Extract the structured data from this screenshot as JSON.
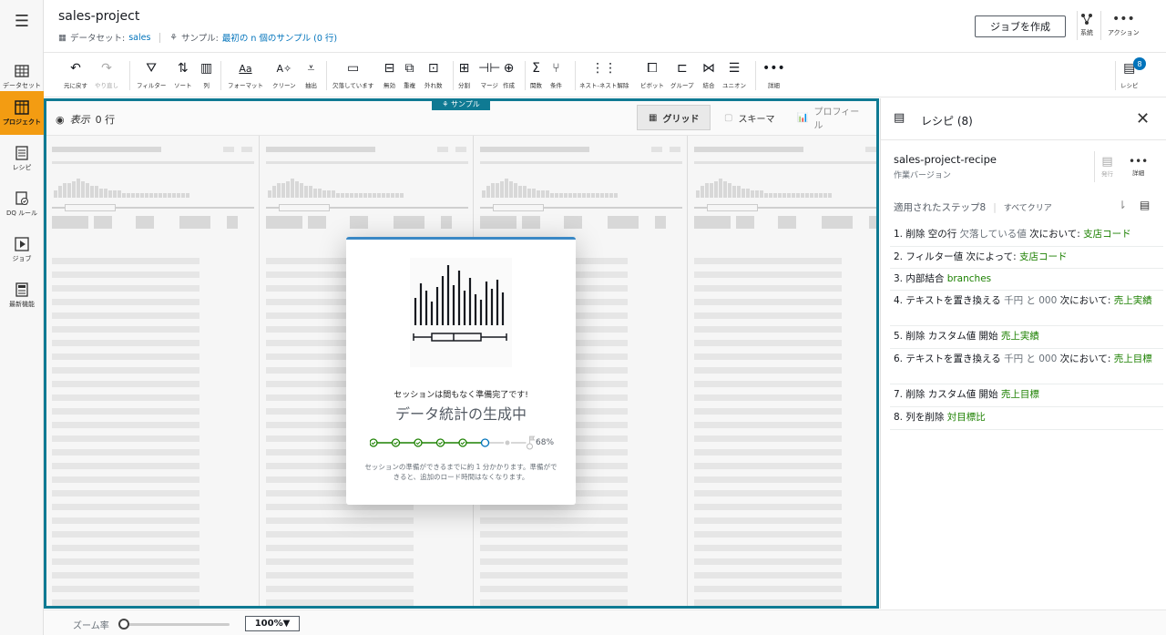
{
  "nav": {
    "items": [
      {
        "label": "データセット"
      },
      {
        "label": "プロジェクト"
      },
      {
        "label": "レシピ"
      },
      {
        "label": "DQ ルール"
      },
      {
        "label": "ジョブ"
      },
      {
        "label": "最新機能"
      }
    ]
  },
  "header": {
    "title": "sales-project",
    "dataset_label": "データセット:",
    "dataset_value": "sales",
    "sample_label": "サンプル:",
    "sample_value": "最初の n 個のサンプル (0 行)",
    "create_job": "ジョブを作成",
    "lineage": "系統",
    "actions": "アクション"
  },
  "toolbar": {
    "undo": "元に戻す",
    "redo": "やり直し",
    "filter": "フィルター",
    "sort": "ソート",
    "column": "列",
    "format": "フォーマット",
    "clean": "クリーン",
    "extract": "抽出",
    "missing": "欠落しています",
    "invalid": "無効",
    "duplicate": "重複",
    "outliers": "外れ数",
    "split": "分割",
    "merge": "マージ",
    "create": "作成",
    "functions": "関数",
    "condition": "条件",
    "nest": "ネスト-ネスト解除",
    "pivot": "ピボット",
    "group": "グループ",
    "join": "結合",
    "union": "ユニオン",
    "more": "詳細",
    "recipe": "レシピ",
    "recipe_count": "8"
  },
  "grid": {
    "sample_tag": "サンプル",
    "view_label": "表示",
    "rows": "0 行",
    "tab_grid": "グリッド",
    "tab_schema": "スキーマ",
    "tab_profile": "プロフィール"
  },
  "modal": {
    "line1": "セッションは間もなく準備完了です!",
    "line2": "データ統計の生成中",
    "percent": "68%",
    "progress": 0.68,
    "note": "セッションの準備ができるまでに約 1 分かかります。準備ができると、追加のロード時間はなくなります。"
  },
  "recipe": {
    "title": "レシピ (8)",
    "name": "sales-project-recipe",
    "version": "作業バージョン",
    "publish": "発行",
    "details": "詳細",
    "steps_label": "適用されたステップ8",
    "clear_all": "すべてクリア",
    "steps": [
      {
        "a": "1. 削除 空の行",
        "b": "欠落している値",
        "c": "次において:",
        "d": "支店コード"
      },
      {
        "a": "2. フィルター値 次によって:",
        "b": "",
        "c": "",
        "d": "支店コード"
      },
      {
        "a": "3. 内部結合",
        "b": "",
        "c": "",
        "d": "branches"
      },
      {
        "a": "4. テキストを置き換える",
        "b": "千円 と 000",
        "c": "次において:",
        "d": "売上実績"
      },
      {
        "a": "5. 削除 カスタム値 開始",
        "b": "",
        "c": "",
        "d": "売上実績"
      },
      {
        "a": "6. テキストを置き換える",
        "b": "千円 と 000",
        "c": "次において:",
        "d": "売上目標"
      },
      {
        "a": "7. 削除 カスタム値 開始",
        "b": "",
        "c": "",
        "d": "売上目標"
      },
      {
        "a": "8. 列を削除",
        "b": "",
        "c": "",
        "d": "対目標比"
      }
    ]
  },
  "footer": {
    "zoom_label": "ズーム率",
    "zoom_value": "100%▼"
  }
}
